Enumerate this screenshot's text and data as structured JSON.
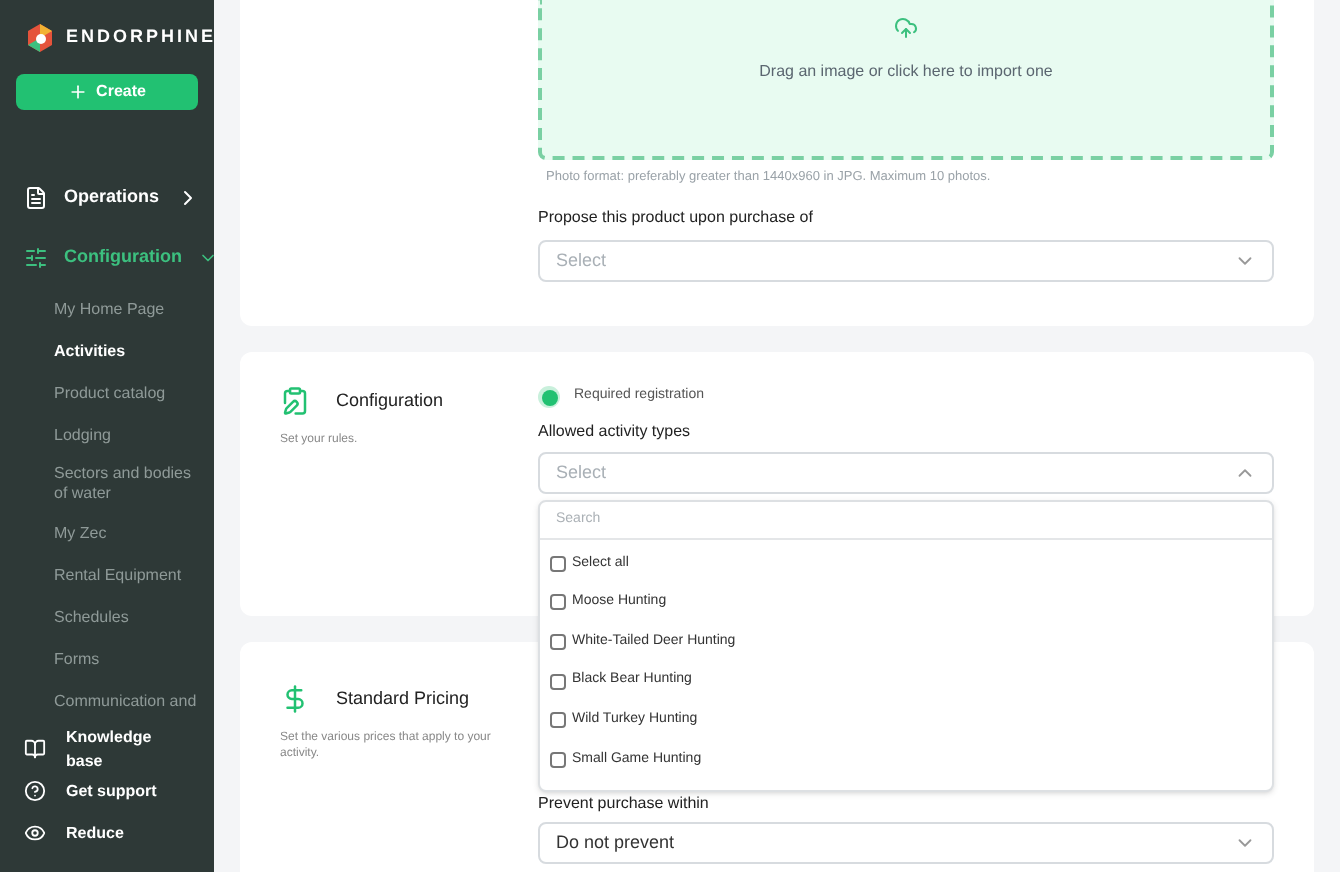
{
  "sidebar": {
    "brand": "ENDORPHINE",
    "create_button": "Create",
    "items": [
      {
        "label": "Operations",
        "expanded": false,
        "selected": false
      },
      {
        "label": "Configuration",
        "expanded": true,
        "selected": true,
        "children": [
          {
            "label": "My Home Page",
            "selected": false
          },
          {
            "label": "Activities",
            "selected": true
          },
          {
            "label": "Product catalog",
            "selected": false
          },
          {
            "label": "Lodging",
            "selected": false
          },
          {
            "label": "Sectors and bodies of water",
            "selected": false
          },
          {
            "label": "My Zec",
            "selected": false
          },
          {
            "label": "Rental Equipment",
            "selected": false
          },
          {
            "label": "Schedules",
            "selected": false
          },
          {
            "label": "Forms",
            "selected": false
          },
          {
            "label": "Communication and",
            "selected": false
          }
        ]
      }
    ],
    "footer": [
      {
        "label": "Knowledge base"
      },
      {
        "label": "Get support"
      },
      {
        "label": "Reduce"
      }
    ]
  },
  "photo_card": {
    "dropzone": "Drag an image or click here to import one",
    "hint": "Photo format: preferably greater than 1440x960 in JPG. Maximum 10 photos.",
    "propose_label": "Propose this product upon purchase of",
    "propose_placeholder": "Select"
  },
  "configuration": {
    "title": "Configuration",
    "subtitle": "Set your rules.",
    "required_registration": {
      "label": "Required registration",
      "checked": true
    },
    "allowed_label": "Allowed activity types",
    "allowed_placeholder": "Select",
    "dropdown": {
      "expanded": true,
      "search_placeholder": "Search",
      "options": [
        {
          "label": "Select all",
          "checked": false
        },
        {
          "label": "Moose Hunting",
          "checked": false
        },
        {
          "label": "White-Tailed Deer Hunting",
          "checked": false
        },
        {
          "label": "Black Bear Hunting",
          "checked": false
        },
        {
          "label": "Wild Turkey Hunting",
          "checked": false
        },
        {
          "label": "Small Game Hunting",
          "checked": false
        }
      ]
    }
  },
  "pricing": {
    "title": "Standard Pricing",
    "subtitle": "Set the various prices that apply to your activity.",
    "prevent_label": "Prevent purchase within",
    "prevent_value": "Do not prevent"
  }
}
